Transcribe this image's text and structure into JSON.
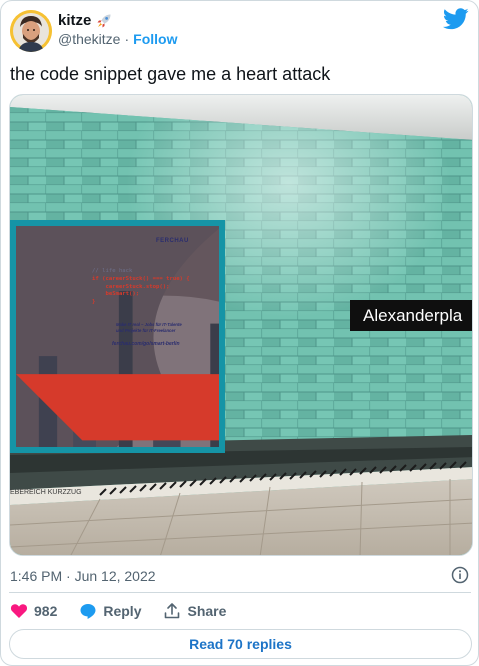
{
  "author": {
    "display_name": "kitze",
    "handle": "@thekitze",
    "separator": "·",
    "follow_label": "Follow"
  },
  "tweet": {
    "text": "the code snippet gave me a heart attack",
    "timestamp": "1:46 PM · Jun 12, 2022"
  },
  "photo": {
    "station_sign": "Alexanderpla",
    "ad": {
      "brand": "FERCHAU",
      "code_comment": "// life hack",
      "code_lines": [
        "if (careerStuck() === true) {",
        "    careerStuck.stop();",
        "    beSmart();",
        "}"
      ],
      "tagline": "Make IT real – Jobs für IT-Talente\nund Projekte für IT-Freelancer",
      "url": "ferchau.com/go/smart-berlin"
    },
    "floor_text": "EBEREICH KURZZUG"
  },
  "actions": {
    "like_count": "982",
    "reply_label": "Reply",
    "share_label": "Share"
  },
  "read_replies_label": "Read 70 replies",
  "colors": {
    "link": "#1d9bf0",
    "like": "#f91880",
    "tile": "#69b9a8",
    "frame": "#1594a6"
  }
}
